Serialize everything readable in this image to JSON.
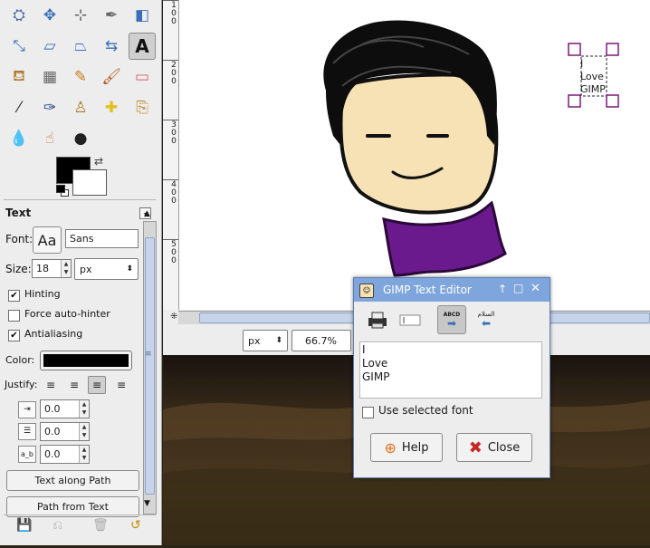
{
  "toolbox": {
    "tools": [
      {
        "name": "fuzzy-select-icon",
        "glyph": "⛭"
      },
      {
        "name": "move-icon",
        "glyph": "✥"
      },
      {
        "name": "align-icon",
        "glyph": "⊹"
      },
      {
        "name": "paths-icon",
        "glyph": "✒"
      },
      {
        "name": "foreground-select-icon",
        "glyph": "◧"
      },
      {
        "name": "scale-icon",
        "glyph": "⤡"
      },
      {
        "name": "shear-icon",
        "glyph": "▱"
      },
      {
        "name": "perspective-icon",
        "glyph": "⏢"
      },
      {
        "name": "flip-icon",
        "glyph": "⇆"
      },
      {
        "name": "text-tool-icon",
        "glyph": "A"
      },
      {
        "name": "bucket-fill-icon",
        "glyph": "⛾"
      },
      {
        "name": "blend-icon",
        "glyph": "▦"
      },
      {
        "name": "pencil-icon",
        "glyph": "✎"
      },
      {
        "name": "paintbrush-icon",
        "glyph": "🖌"
      },
      {
        "name": "eraser-icon",
        "glyph": "▭"
      },
      {
        "name": "color-picker-icon",
        "glyph": "⁄"
      },
      {
        "name": "ink-icon",
        "glyph": "✑"
      },
      {
        "name": "clone-icon",
        "glyph": "♙"
      },
      {
        "name": "heal-icon",
        "glyph": "✚"
      },
      {
        "name": "perspective-clone-icon",
        "glyph": "⎘"
      },
      {
        "name": "blur-icon",
        "glyph": "💧"
      },
      {
        "name": "smudge-icon",
        "glyph": "☝"
      },
      {
        "name": "dodge-burn-icon",
        "glyph": "●"
      }
    ],
    "swap_glyph": "⇄"
  },
  "text_options": {
    "title": "Text",
    "font_label": "Font:",
    "font_preview": "Aa",
    "font_value": "Sans",
    "size_label": "Size:",
    "size_value": "18",
    "size_unit": "px",
    "hinting_label": "Hinting",
    "hinting_checked": true,
    "force_autohinter_label": "Force auto-hinter",
    "force_autohinter_checked": false,
    "antialiasing_label": "Antialiasing",
    "antialiasing_checked": true,
    "color_label": "Color:",
    "color_value": "#000000",
    "justify_label": "Justify:",
    "indent_value": "0.0",
    "line_spacing_value": "0.0",
    "letter_spacing_value": "0.0",
    "letter_spacing_icon_text": "a_b",
    "text_along_path_button": "Text along Path",
    "path_from_text_button": "Path from Text",
    "pin_glyph": "◂"
  },
  "rulers": {
    "vertical_marks": [
      "100",
      "200",
      "300",
      "400",
      "500"
    ]
  },
  "canvas": {
    "text_layer_lines": [
      "I",
      "Love",
      "GIMP"
    ],
    "bowtie_color": "#6a1a8c",
    "face_color": "#f6e2b4"
  },
  "statusbar": {
    "unit": "px",
    "zoom": "66.7%"
  },
  "text_editor": {
    "title": "GIMP Text Editor",
    "content": "I\nLove\nGIMP",
    "ltr_label": "ABCD",
    "rtl_label": "السلام",
    "use_selected_font_label": "Use selected font",
    "use_selected_font_checked": false,
    "help_button": "Help",
    "close_button": "Close"
  }
}
